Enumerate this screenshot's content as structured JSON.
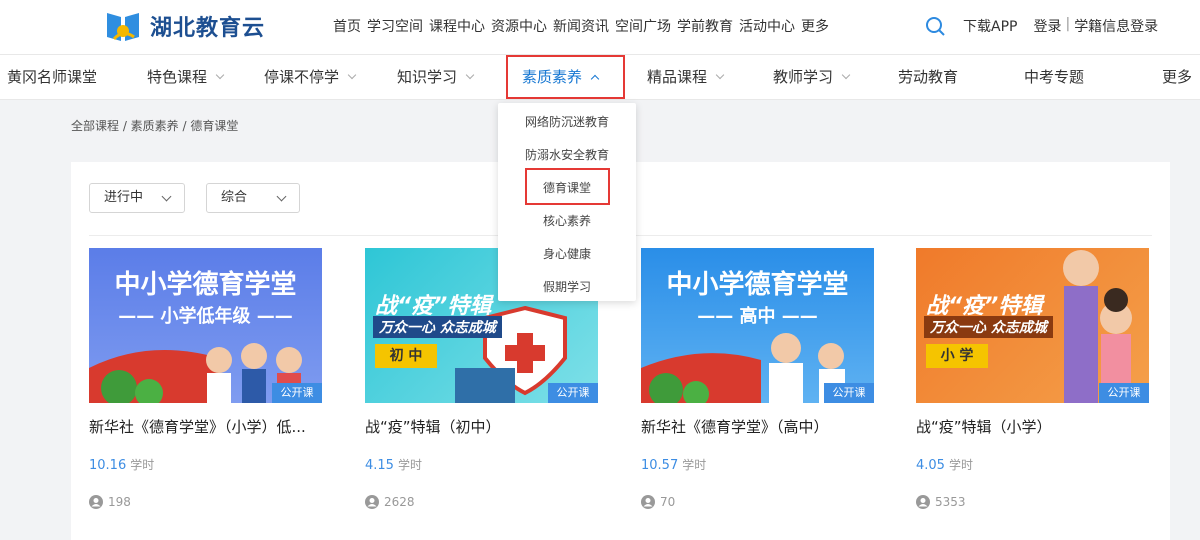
{
  "logo": {
    "name": "湖北教育云"
  },
  "topnav": [
    "首页",
    "学习空间",
    "课程中心",
    "资源中心",
    "新闻资讯",
    "空间广场",
    "学前教育",
    "活动中心",
    "更多"
  ],
  "toplinks": {
    "download": "下载APP",
    "login": "登录",
    "student_login": "学籍信息登录",
    "sep": "|"
  },
  "subnav": [
    {
      "label": "黄冈名师课堂",
      "chev": false
    },
    {
      "label": "特色课程",
      "chev": true
    },
    {
      "label": "停课不停学",
      "chev": true
    },
    {
      "label": "知识学习",
      "chev": true
    },
    {
      "label": "素质素养",
      "chev": true,
      "active": true
    },
    {
      "label": "精品课程",
      "chev": true
    },
    {
      "label": "教师学习",
      "chev": true
    },
    {
      "label": "劳动教育",
      "chev": false
    },
    {
      "label": "中考专题",
      "chev": false
    },
    {
      "label": "更多",
      "chev": false
    }
  ],
  "breadcrumb": "全部课程 / 素质素养 / 德育课堂",
  "filters": {
    "status": "进行中",
    "sort": "综合"
  },
  "dropdown": [
    "网络防沉迷教育",
    "防溺水安全教育",
    "德育课堂",
    "核心素养",
    "身心健康",
    "假期学习"
  ],
  "cards": [
    {
      "thumb_l1": "中小学德育学堂",
      "thumb_l2": "—— 小学低年级 ——",
      "badge": "公开课",
      "title": "新华社《德育学堂》（小学）低...",
      "hours": "10.16",
      "hours_unit": "学时",
      "views": "198"
    },
    {
      "thumb_l1": "战“疫”特辑",
      "thumb_l2": "万众一心 众志成城",
      "thumb_tag": "初 中",
      "badge": "公开课",
      "title": "战“疫”特辑（初中）",
      "hours": "4.15",
      "hours_unit": "学时",
      "views": "2628"
    },
    {
      "thumb_l1": "中小学德育学堂",
      "thumb_l2": "—— 高中 ——",
      "badge": "公开课",
      "title": "新华社《德育学堂》（高中）",
      "hours": "10.57",
      "hours_unit": "学时",
      "views": "70"
    },
    {
      "thumb_l1": "战“疫”特辑",
      "thumb_l2": "万众一心 众志成城",
      "thumb_tag": "小 学",
      "badge": "公开课",
      "title": "战“疫”特辑（小学）",
      "hours": "4.05",
      "hours_unit": "学时",
      "views": "5353"
    }
  ],
  "colors": {
    "accent": "#1677d2",
    "highlight": "#e53935",
    "badge": "#3d8de3"
  }
}
